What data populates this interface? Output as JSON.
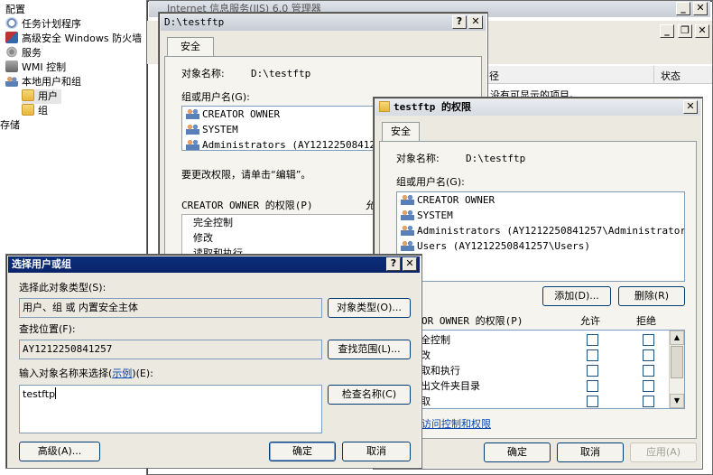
{
  "tree": {
    "items": [
      {
        "label": "配置",
        "icon": "config-icon"
      },
      {
        "label": "任务计划程序",
        "icon": "clock-icon"
      },
      {
        "label": "高级安全 Windows 防火墙",
        "icon": "firewall-icon"
      },
      {
        "label": "服务",
        "icon": "gear-icon"
      },
      {
        "label": "WMI 控制",
        "icon": "wmi-icon"
      },
      {
        "label": "本地用户和组",
        "icon": "users-icon"
      },
      {
        "label": "用户",
        "icon": "folder-icon"
      },
      {
        "label": "组",
        "icon": "folder-icon"
      },
      {
        "label": "存储",
        "icon": "disk-icon"
      }
    ]
  },
  "iis": {
    "title": "Internet 信息服务(IIS) 6.0 管理器",
    "col_status": "状态",
    "col_partial": "径",
    "empty_msg": "没有可显示的项目。"
  },
  "props": {
    "title": "D:\\testftp",
    "tab_security": "安全",
    "object_label": "对象名称:",
    "object_value": "D:\\testftp",
    "group_label": "组或用户名(G):",
    "users": [
      "CREATOR OWNER",
      "SYSTEM",
      "Administrators (AY1212250841257\\Administrators)"
    ],
    "change_hint": "要更改权限，请单击“编辑”。",
    "perm_label": "CREATOR OWNER 的权限(P)",
    "allow_partial": "允",
    "perms": [
      "完全控制",
      "修改",
      "读取和执行"
    ]
  },
  "perms_dialog": {
    "title": "testftp 的权限",
    "tab_security": "安全",
    "object_label": "对象名称:",
    "object_value": "D:\\testftp",
    "group_label": "组或用户名(G):",
    "users": [
      "CREATOR OWNER",
      "SYSTEM",
      "Administrators (AY1212250841257\\Administrators)",
      "Users (AY1212250841257\\Users)"
    ],
    "add_btn": "添加(D)...",
    "remove_btn": "删除(R)",
    "perm_label": "OR OWNER 的权限(P)",
    "allow": "允许",
    "deny": "拒绝",
    "perms": [
      "全控制",
      "改",
      "取和执行",
      "出文件夹目录",
      "取"
    ],
    "special_link": "访问控制和权限",
    "ok": "确定",
    "cancel": "取消",
    "apply": "应用(A)"
  },
  "select_dialog": {
    "title": "选择用户或组",
    "type_label": "选择此对象类型(S):",
    "type_value": "用户、组 或 内置安全主体",
    "type_btn": "对象类型(O)...",
    "loc_label": "查找位置(F):",
    "loc_value": "AY1212250841257",
    "loc_btn": "查找范围(L)...",
    "name_label_pre": "输入对象名称来选择(",
    "name_label_link": "示例",
    "name_label_post": ")(E):",
    "name_value": "testftp",
    "check_btn": "检查名称(C)",
    "advanced_btn": "高级(A)...",
    "ok": "确定",
    "cancel": "取消"
  }
}
